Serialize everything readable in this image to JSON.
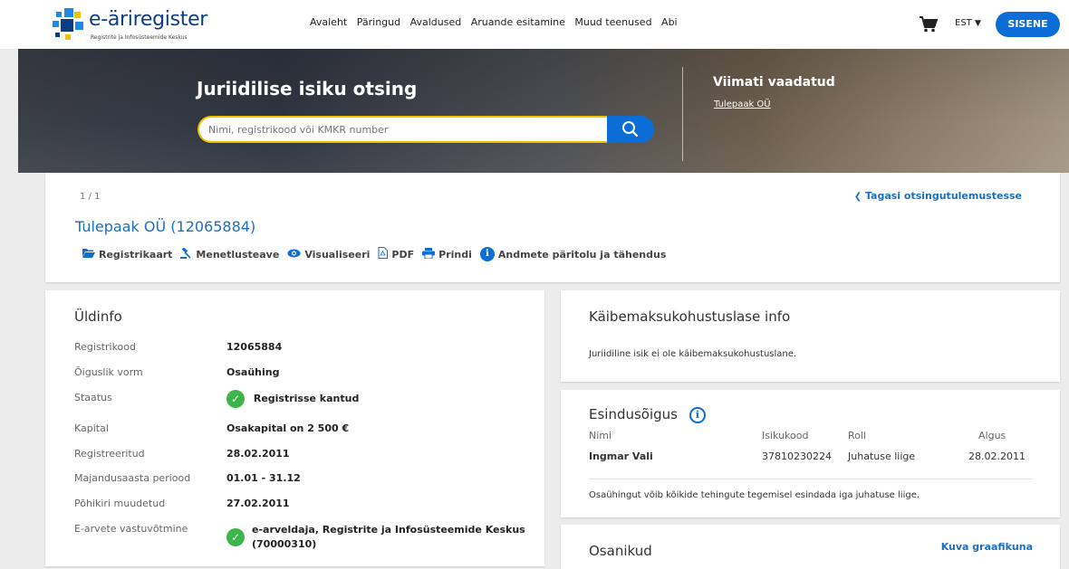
{
  "header": {
    "logo_title": "e-äriregister",
    "logo_sub": "Registrite ja Infosüsteemide Keskus",
    "nav": [
      "Avaleht",
      "Päringud",
      "Avaldused",
      "Aruande esitamine",
      "Muud teenused",
      "Abi"
    ],
    "lang": "EST",
    "login": "SISENE"
  },
  "hero": {
    "title": "Juriidilise isiku otsing",
    "search_placeholder": "Nimi, registrikood või KMKR number",
    "recent_title": "Viimati vaadatud",
    "recent_link": "Tulepaak OÜ"
  },
  "company": {
    "pager": "1 / 1",
    "back": "Tagasi otsingutulemustesse",
    "name": "Tulepaak OÜ (12065884)",
    "actions": [
      "Registrikaart",
      "Menetlusteave",
      "Visualiseeri",
      "PDF",
      "Prindi",
      "Andmete päritolu ja tähendus"
    ]
  },
  "general": {
    "title": "Üldinfo",
    "rows": [
      {
        "label": "Registrikood",
        "value": "12065884"
      },
      {
        "label": "Õiguslik vorm",
        "value": "Osaühing"
      },
      {
        "label": "Staatus",
        "value": "Registrisse kantud"
      },
      {
        "label": "Kapital",
        "value": "Osakapital on 2 500 €"
      },
      {
        "label": "Registreeritud",
        "value": "28.02.2011"
      },
      {
        "label": "Majandusaasta periood",
        "value": "01.01 - 31.12"
      },
      {
        "label": "Põhikiri muudetud",
        "value": "27.02.2011"
      },
      {
        "label": "E-arvete vastuvõtmine",
        "value": "e-arveldaja, Registrite ja Infosüsteemide Keskus",
        "value2": "(70000310)"
      }
    ]
  },
  "vat": {
    "title": "Käibemaksukohustuslase info",
    "text": "Juriidiline isik ei ole käibemaksukohustuslane."
  },
  "representation": {
    "title": "Esindusõigus",
    "headers": [
      "Nimi",
      "Isikukood",
      "Roll",
      "Algus"
    ],
    "row": [
      "Ingmar Vali",
      "37810230224",
      "Juhatuse liige",
      "28.02.2011"
    ],
    "note": "Osaühingut võib kõikide tehingute tegemisel esindada iga juhatuse liige."
  },
  "owners": {
    "title": "Osanikud",
    "link": "Kuva graafikuna"
  },
  "colors": {
    "accent": "#0d6dd6",
    "link": "#1c6fbf",
    "success": "#3cb54a",
    "search_border": "#f2c200"
  }
}
